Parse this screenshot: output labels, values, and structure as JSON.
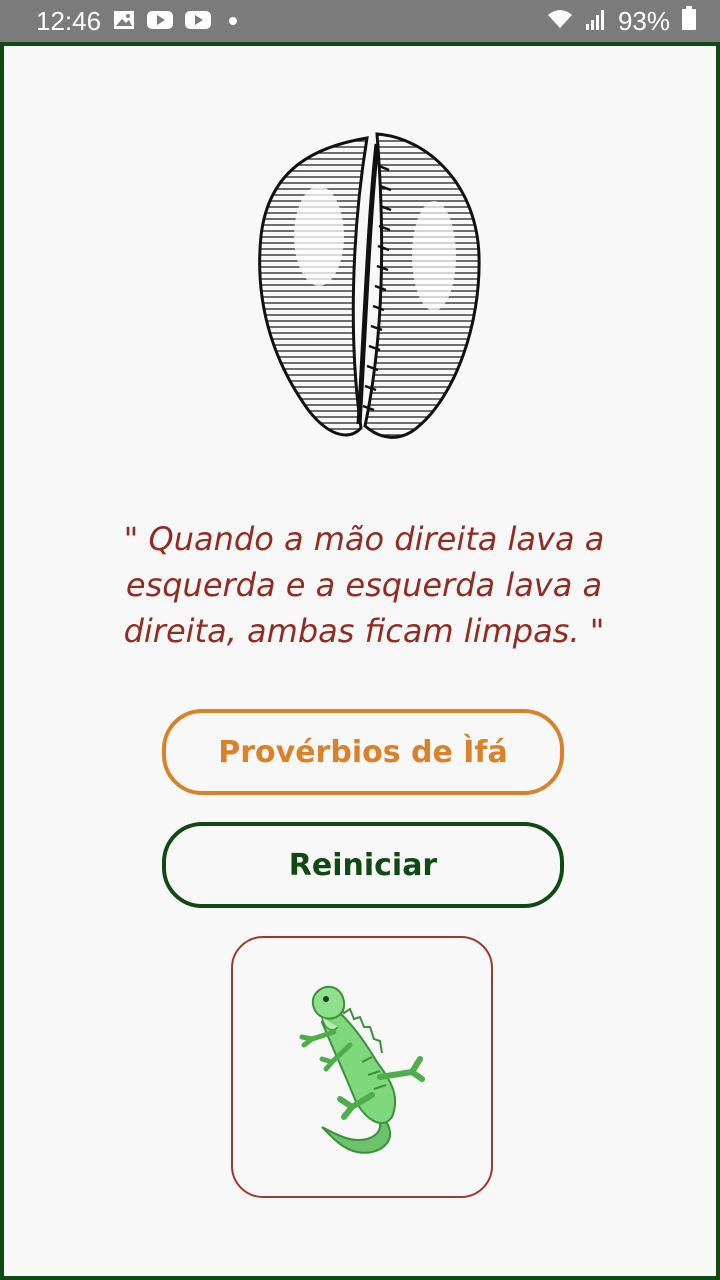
{
  "status_bar": {
    "time": "12:46",
    "battery": "93%",
    "icons": [
      "image-icon",
      "youtube-icon",
      "youtube-icon",
      "dot-icon",
      "wifi-icon",
      "signal-icon",
      "battery-icon"
    ]
  },
  "main": {
    "shell_image": "cowrie-shell-icon",
    "proverb": "\" Quando a mão direita lava a esquerda e a esquerda lava a direita, ambas ficam limpas. \"",
    "buttons": {
      "proverbios": "Provérbios de Ìfá",
      "reiniciar": "Reiniciar"
    },
    "card_image": "iguana-icon"
  },
  "colors": {
    "frame": "#0f4a12",
    "proverb_text": "#922b21",
    "proverbios_accent": "#d9822b",
    "reiniciar_accent": "#0f4a12",
    "card_border": "#9c3a2c",
    "status_bar": "#7b7b7b"
  }
}
